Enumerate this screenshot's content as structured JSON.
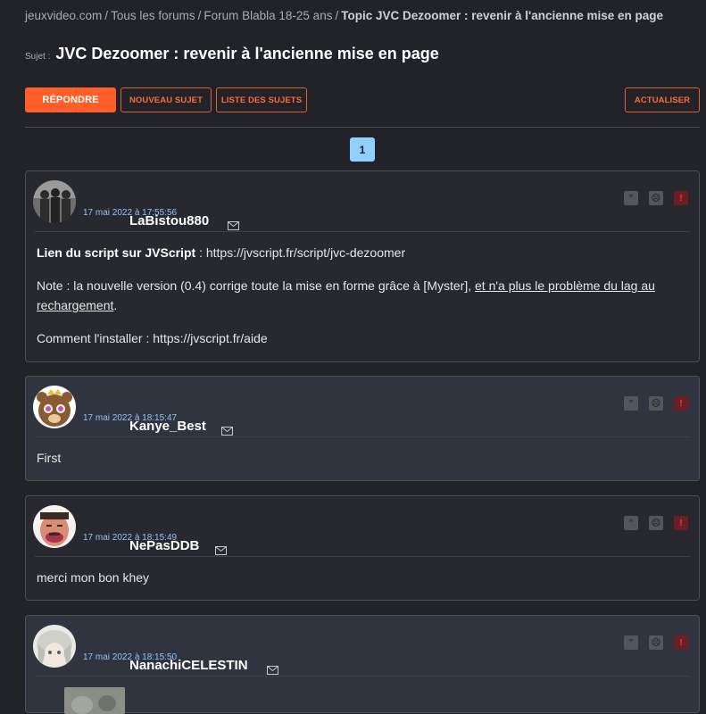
{
  "breadcrumb": {
    "items": [
      "jeuxvideo.com",
      "Tous les forums",
      "Forum Blabla 18-25 ans"
    ],
    "separator": "/",
    "current": "Topic JVC Dezoomer : revenir à l'ancienne mise en page"
  },
  "subject": {
    "label": "Sujet :",
    "title": "JVC Dezoomer : revenir à l'ancienne mise en page"
  },
  "toolbar": {
    "reply": "RÉPONDRE",
    "new_topic": "NOUVEAU SUJET",
    "topic_list": "LISTE DES SUJETS",
    "refresh": "ACTUALISER"
  },
  "pagination": {
    "current": "1"
  },
  "colors": {
    "accent": "#ff5e2b",
    "date": "#8fc3ff",
    "page": "#8fd0ff",
    "alert": "#e04040"
  },
  "posts": [
    {
      "author": "LaBistou880",
      "date": "17 mai 2022 à 17:55:56",
      "avatar": "silhouettes-avatar",
      "p1_bold": "Lien du script sur JVScript",
      "p1_rest": " : https://jvscript.fr/script/jvc-dezoomer",
      "p2_start": "Note : la nouvelle version (0.4) corrige toute la mise en forme grâce à [Myster], ",
      "p2_link1": "et n'a plus le problème du lag au",
      "p2_link2": "rechargement",
      "p2_end": ".",
      "p3": "Comment l'installer : https://jvscript.fr/aide"
    },
    {
      "author": "Kanye_Best",
      "date": "17 mai 2022 à 18:15:47",
      "avatar": "bear-avatar",
      "text": "First"
    },
    {
      "author": "NePasDDB",
      "date": "17 mai 2022 à 18:15:49",
      "avatar": "risitas-avatar",
      "text": "merci mon bon khey"
    },
    {
      "author": "NanachiCELESTIN",
      "date": "17 mai 2022 à 18:15:50",
      "avatar": "anime-avatar"
    }
  ],
  "icons": {
    "quote": "quote-icon",
    "ddb": "ddb-icon",
    "alert": "alert-icon",
    "mail": "mail-icon"
  }
}
